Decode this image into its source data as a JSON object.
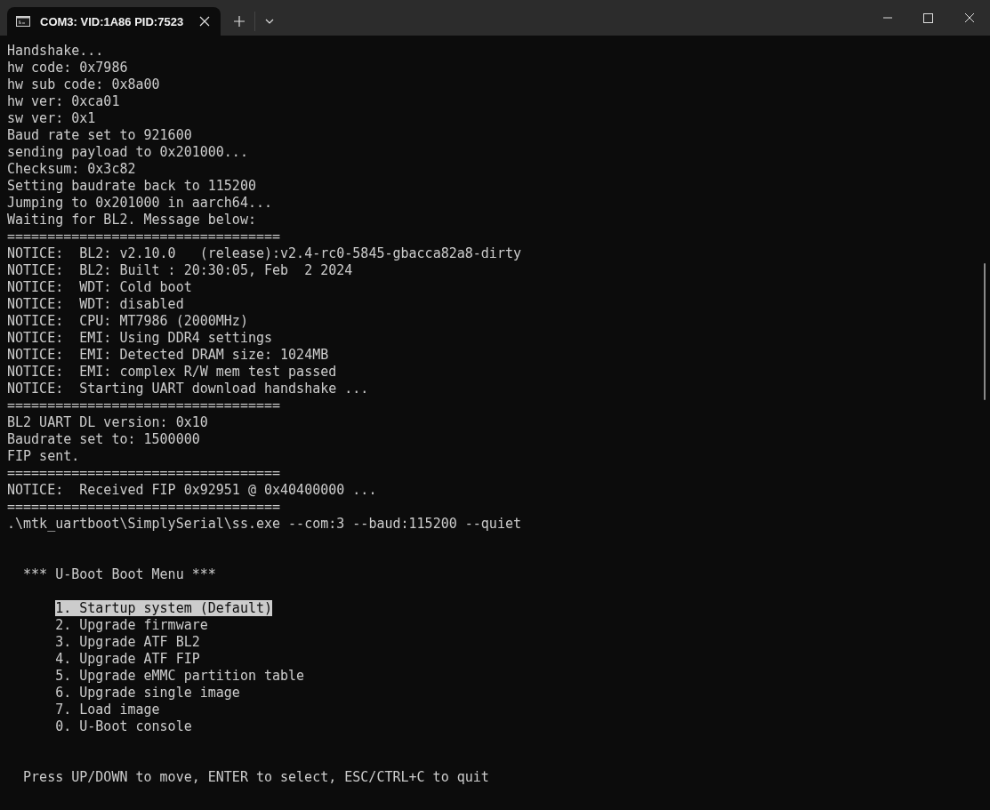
{
  "tab": {
    "title": "COM3: VID:1A86 PID:7523",
    "selected": true
  },
  "log_lines": [
    "Handshake...",
    "hw code: 0x7986",
    "hw sub code: 0x8a00",
    "hw ver: 0xca01",
    "sw ver: 0x1",
    "Baud rate set to 921600",
    "sending payload to 0x201000...",
    "Checksum: 0x3c82",
    "Setting baudrate back to 115200",
    "Jumping to 0x201000 in aarch64...",
    "Waiting for BL2. Message below:",
    "==================================",
    "NOTICE:  BL2: v2.10.0   (release):v2.4-rc0-5845-gbacca82a8-dirty",
    "NOTICE:  BL2: Built : 20:30:05, Feb  2 2024",
    "NOTICE:  WDT: Cold boot",
    "NOTICE:  WDT: disabled",
    "NOTICE:  CPU: MT7986 (2000MHz)",
    "NOTICE:  EMI: Using DDR4 settings",
    "NOTICE:  EMI: Detected DRAM size: 1024MB",
    "NOTICE:  EMI: complex R/W mem test passed",
    "NOTICE:  Starting UART download handshake ...",
    "==================================",
    "BL2 UART DL version: 0x10",
    "Baudrate set to: 1500000",
    "FIP sent.",
    "==================================",
    "NOTICE:  Received FIP 0x92951 @ 0x40400000 ...",
    "==================================",
    ".\\mtk_uartboot\\SimplySerial\\ss.exe --com:3 --baud:115200 --quiet"
  ],
  "menu": {
    "title": "*** U-Boot Boot Menu ***",
    "items": [
      {
        "label": "1. Startup system (Default)",
        "selected": true
      },
      {
        "label": "2. Upgrade firmware",
        "selected": false
      },
      {
        "label": "3. Upgrade ATF BL2",
        "selected": false
      },
      {
        "label": "4. Upgrade ATF FIP",
        "selected": false
      },
      {
        "label": "5. Upgrade eMMC partition table",
        "selected": false
      },
      {
        "label": "6. Upgrade single image",
        "selected": false
      },
      {
        "label": "7. Load image",
        "selected": false
      },
      {
        "label": "0. U-Boot console",
        "selected": false
      }
    ],
    "hint": "Press UP/DOWN to move, ENTER to select, ESC/CTRL+C to quit"
  }
}
